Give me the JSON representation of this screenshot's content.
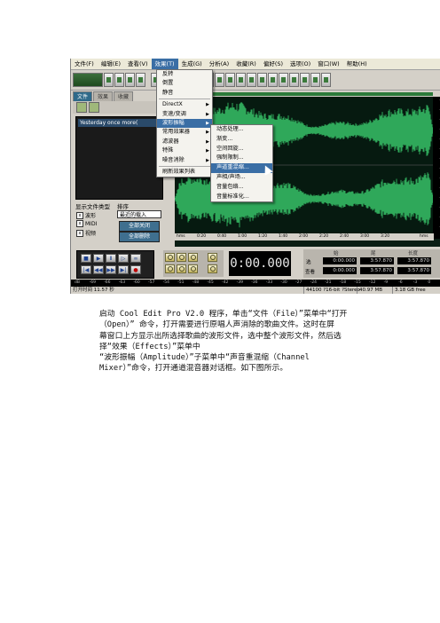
{
  "menubar": [
    "文件(F)",
    "编辑(E)",
    "查看(V)",
    "效果(T)",
    "生成(G)",
    "分析(A)",
    "收藏(R)",
    "偏好(S)",
    "选项(O)",
    "窗口(W)",
    "帮助(H)"
  ],
  "effects_menu": {
    "items": [
      "反转",
      "倒置",
      "静音",
      "DirectX",
      "变速/变调",
      "波形振幅",
      "常用效果器",
      "滤波器",
      "特殊",
      "噪音消除",
      "刷新效果列表"
    ],
    "highlighted": "波形振幅"
  },
  "amplitude_submenu": {
    "items": [
      "动态处理...",
      "渐变...",
      "空间回旋...",
      "强制限制...",
      "声道重混缩...",
      "声相/声场...",
      "音量包络...",
      "音量标准化..."
    ],
    "highlighted": "声道重混缩..."
  },
  "left_panel": {
    "tabs": [
      "文件",
      "效果",
      "收藏"
    ],
    "file_entry": "Yesterday once more(",
    "show_type_label": "显示文件类型",
    "sort_label": "排序",
    "types": [
      "波形",
      "MIDI",
      "视频"
    ],
    "sort_value": "最近的载入",
    "buttons": [
      "全部关闭",
      "全部删除"
    ]
  },
  "timeline": [
    "hms",
    "0:20",
    "0:40",
    "1:00",
    "1:20",
    "1:40",
    "2:00",
    "2:20",
    "2:40",
    "3:00",
    "3:20",
    "hms"
  ],
  "time_display": "0:00.000",
  "selection": {
    "headers": [
      "始",
      "尾",
      "长度"
    ],
    "rows": [
      {
        "label": "选",
        "start": "0:00.000",
        "end": "3:57.870",
        "length": "3:57.870"
      },
      {
        "label": "查看",
        "start": "0:00.000",
        "end": "3:57.870",
        "length": "3:57.870"
      }
    ]
  },
  "level_scale": [
    "dB",
    "-69",
    "-66",
    "-63",
    "-60",
    "-57",
    "-54",
    "-51",
    "-48",
    "-45",
    "-42",
    "-39",
    "-36",
    "-33",
    "-30",
    "-27",
    "-24",
    "-21",
    "-18",
    "-15",
    "-12",
    "-9",
    "-6",
    "-3",
    "0"
  ],
  "status": {
    "open_time": "打开时间 11.57 秒",
    "format": "44100 ?16-bit ?Stereo",
    "size": "40.97 MB",
    "free": "3.18 GB free"
  },
  "caption_lines": [
    "启动 Cool Edit Pro V2.0 程序，单击“文件（File）”菜单中“打开",
    "（Open）”  命令，打开需要进行原唱人声消除的歌曲文件。这时在屏",
    "幕窗口上方显示出所选择歌曲的波形文件，选中整个波形文件，然后选",
    "择“效果（Effects）”菜单中",
    "“波形振幅（Amplitude）”子菜单中“声音重混缩（Channel",
    "Mixer）”命令，打开通道混音器对话框。如下图所示。"
  ]
}
